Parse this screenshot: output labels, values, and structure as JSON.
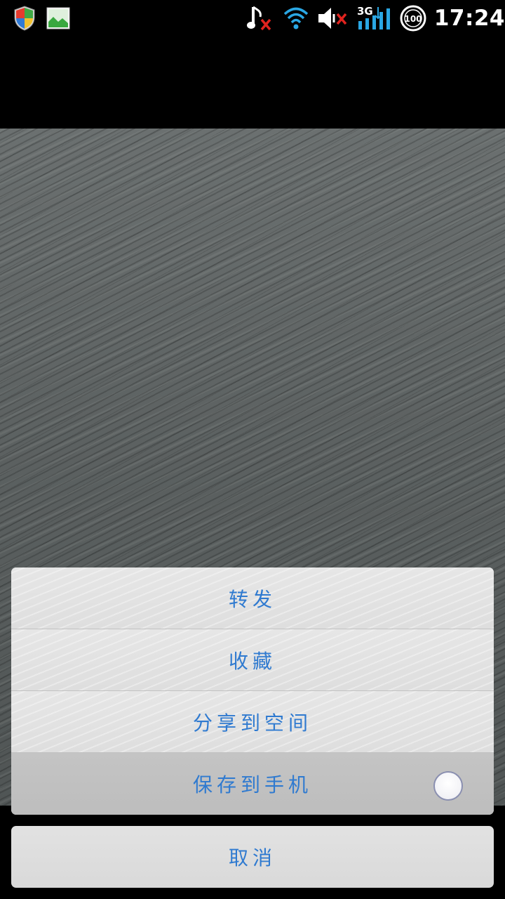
{
  "status_bar": {
    "time": "17:24",
    "battery_level": "100",
    "network_type": "3G",
    "icons": [
      "shield-icon",
      "gallery-icon",
      "music-muted-icon",
      "wifi-icon",
      "volume-muted-icon",
      "signal-icon",
      "battery-icon"
    ]
  },
  "action_sheet": {
    "items": [
      {
        "label": "转发"
      },
      {
        "label": "收藏"
      },
      {
        "label": "分享到空间"
      },
      {
        "label": "保存到手机"
      }
    ],
    "pressed_index": 3,
    "cancel_label": "取消"
  },
  "colors": {
    "accent_text": "#2f7ad0",
    "sheet_background": "#e3e3e3",
    "pressed_background": "#c2c2c2"
  }
}
